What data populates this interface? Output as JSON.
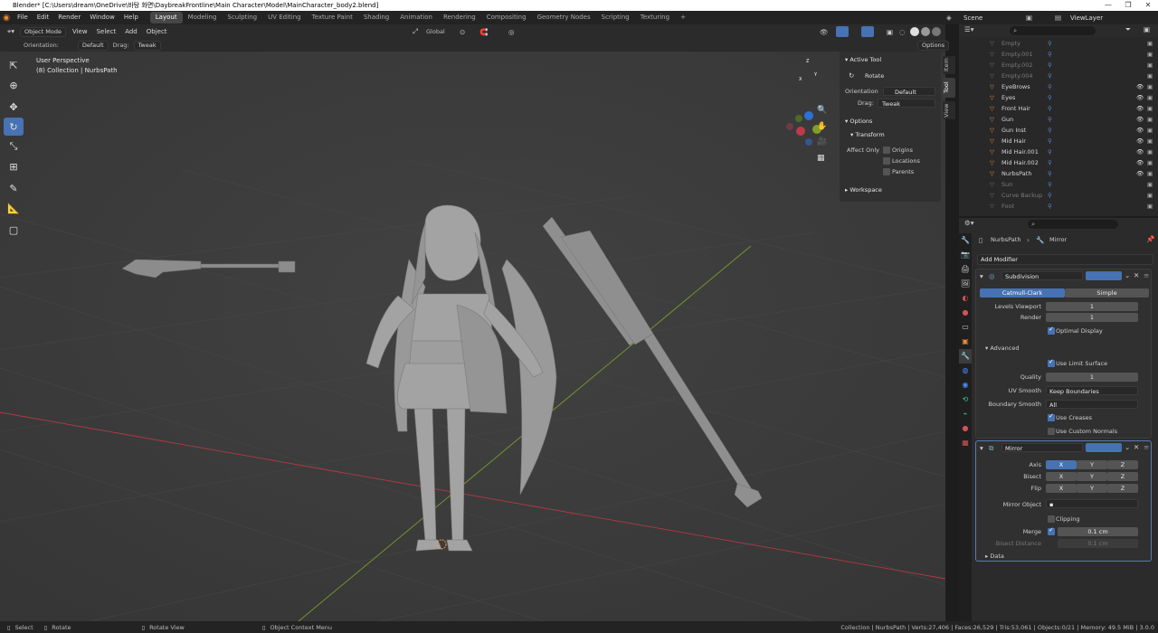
{
  "window": {
    "title": "Blender* [C:\\Users\\dream\\OneDrive\\바탕 화면\\DaybreakFrontline\\Main Character\\Model\\MainCharacter_body2.blend]"
  },
  "menubar": {
    "menus": [
      "File",
      "Edit",
      "Render",
      "Window",
      "Help"
    ],
    "workspaces": [
      "Layout",
      "Modeling",
      "Sculpting",
      "UV Editing",
      "Texture Paint",
      "Shading",
      "Animation",
      "Rendering",
      "Compositing",
      "Geometry Nodes",
      "Scripting",
      "Texturing"
    ],
    "add_tab": "+",
    "scene": "Scene",
    "view_layer": "ViewLayer"
  },
  "header": {
    "mode": "Object Mode",
    "menus": [
      "View",
      "Select",
      "Add",
      "Object"
    ],
    "transform_orientation": "Global",
    "options": "Options"
  },
  "header2": {
    "orientation_label": "Orientation:",
    "orientation_value": "Default",
    "drag_label": "Drag:",
    "drag_value": "Tweak"
  },
  "viewport": {
    "perspective": "User Perspective",
    "collection": "(8) Collection | NurbsPath",
    "gizmo": {
      "x": "X",
      "y": "Y",
      "z": "Z"
    }
  },
  "npanel": {
    "active_tool_title": "Active Tool",
    "tool_name": "Rotate",
    "orientation_label": "Orientation",
    "orientation_value": "Default",
    "drag_label": "Drag:",
    "drag_value": "Tweak",
    "options_title": "Options",
    "transform_title": "Transform",
    "affect_only": "Affect Only",
    "origins": "Origins",
    "locations": "Locations",
    "parents": "Parents",
    "workspace_title": "Workspace",
    "tabs": [
      "Item",
      "Tool",
      "View"
    ]
  },
  "outliner": {
    "items": [
      {
        "name": "Empty",
        "dim": true
      },
      {
        "name": "Empty.001",
        "dim": true
      },
      {
        "name": "Empty.002",
        "dim": true
      },
      {
        "name": "Empty.004",
        "dim": true
      },
      {
        "name": "EyeBrows",
        "dim": false
      },
      {
        "name": "Eyes",
        "dim": false
      },
      {
        "name": "Front Hair",
        "dim": false
      },
      {
        "name": "Gun",
        "dim": false
      },
      {
        "name": "Gun Inst",
        "dim": false
      },
      {
        "name": "Mid Hair",
        "dim": false
      },
      {
        "name": "Mid Hair.001",
        "dim": false
      },
      {
        "name": "Mid Hair.002",
        "dim": false
      },
      {
        "name": "NurbsPath",
        "dim": false
      },
      {
        "name": "Sun",
        "dim": true
      },
      {
        "name": "Curve Backup",
        "dim": true
      },
      {
        "name": "Foot",
        "dim": true
      }
    ]
  },
  "properties": {
    "breadcrumb_object": "NurbsPath",
    "breadcrumb_modifier": "Mirror",
    "add_modifier": "Add Modifier",
    "subdivision": {
      "name": "Subdivision",
      "catmull": "Catmull-Clark",
      "simple": "Simple",
      "levels_viewport_label": "Levels Viewport",
      "levels_viewport": "1",
      "render_label": "Render",
      "render": "1",
      "optimal_display": "Optimal Display",
      "advanced": "Advanced",
      "use_limit_surface": "Use Limit Surface",
      "quality_label": "Quality",
      "quality": "1",
      "uv_smooth_label": "UV Smooth",
      "uv_smooth": "Keep Boundaries",
      "boundary_smooth_label": "Boundary Smooth",
      "boundary_smooth": "All",
      "use_creases": "Use Creases",
      "use_custom_normals": "Use Custom Normals"
    },
    "mirror": {
      "name": "Mirror",
      "axis_label": "Axis",
      "bisect_label": "Bisect",
      "flip_label": "Flip",
      "x": "X",
      "y": "Y",
      "z": "Z",
      "mirror_object_label": "Mirror Object",
      "clipping": "Clipping",
      "merge_label": "Merge",
      "merge_value": "0.1 cm",
      "bisect_distance_label": "Bisect Distance",
      "bisect_distance_value": "0.1 cm",
      "data": "Data"
    }
  },
  "statusbar": {
    "select": "Select",
    "rotate": "Rotate",
    "rotate_view": "Rotate View",
    "context_menu": "Object Context Menu",
    "stats": "Collection | NurbsPath | Verts:27,406 | Faces:26,529 | Tris:53,061 | Objects:0/21 | Memory: 49.5 MiB | 3.0.0"
  },
  "colors": {
    "accent": "#4772b3",
    "x_axis": "#c0394b",
    "y_axis": "#7ea02a",
    "z_axis": "#2c70d8"
  }
}
